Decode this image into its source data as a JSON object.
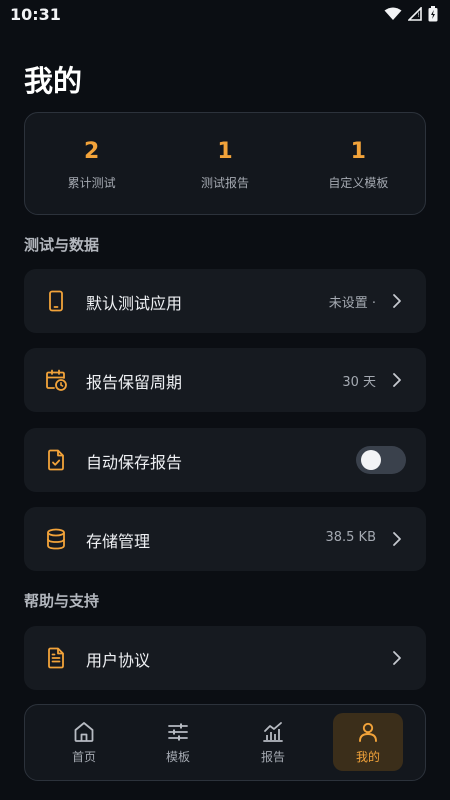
{
  "status_bar": {
    "time": "10:31"
  },
  "page": {
    "title": "我的"
  },
  "stats": [
    {
      "value": "2",
      "label": "累计测试"
    },
    {
      "value": "1",
      "label": "测试报告"
    },
    {
      "value": "1",
      "label": "自定义模板"
    }
  ],
  "sections": {
    "test_data": {
      "title": "测试与数据"
    },
    "help": {
      "title": "帮助与支持"
    }
  },
  "rows": {
    "default_app": {
      "label": "默认测试应用",
      "value": "未设置 ·",
      "icon": "phone-icon"
    },
    "retention": {
      "label": "报告保留周期",
      "value": "30 天",
      "icon": "calendar-clock-icon"
    },
    "auto_save": {
      "label": "自动保存报告",
      "icon": "file-check-icon",
      "enabled": false
    },
    "storage": {
      "label": "存储管理",
      "value": "38.5 KB",
      "icon": "database-icon"
    },
    "agreement": {
      "label": "用户协议",
      "icon": "document-icon"
    }
  },
  "nav": {
    "items": [
      {
        "label": "首页",
        "icon": "home-icon"
      },
      {
        "label": "模板",
        "icon": "sliders-icon"
      },
      {
        "label": "报告",
        "icon": "chart-icon"
      },
      {
        "label": "我的",
        "icon": "user-icon"
      }
    ],
    "active_index": 3
  },
  "colors": {
    "accent": "#f2a33a",
    "background": "#0b0e13",
    "card": "#161a20"
  }
}
